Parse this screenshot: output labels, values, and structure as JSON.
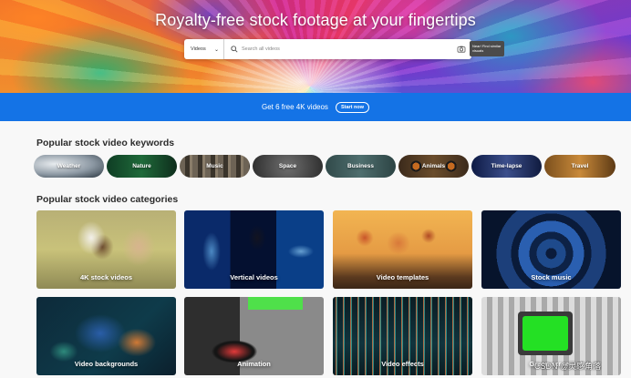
{
  "hero": {
    "title": "Royalty-free stock footage at your fingertips",
    "search": {
      "category": "Videos",
      "placeholder": "Search all videos",
      "tooltip": "Near! Find similar visuals"
    }
  },
  "promo": {
    "text": "Get 6 free 4K videos",
    "button": "Start now"
  },
  "keywords": {
    "title": "Popular stock video keywords",
    "items": [
      "Weather",
      "Nature",
      "Music",
      "Space",
      "Business",
      "Animals",
      "Time-lapse",
      "Travel"
    ]
  },
  "categories": {
    "title": "Popular stock video categories",
    "items": [
      "4K stock videos",
      "Vertical videos",
      "Video templates",
      "Stock music",
      "Video backgrounds",
      "Animation",
      "Video effects",
      "Green screen"
    ]
  },
  "watermark": "CSDN @灵感角落",
  "colors": {
    "promo_blue": "#1473e6",
    "page_bg": "#f8f8f8"
  }
}
